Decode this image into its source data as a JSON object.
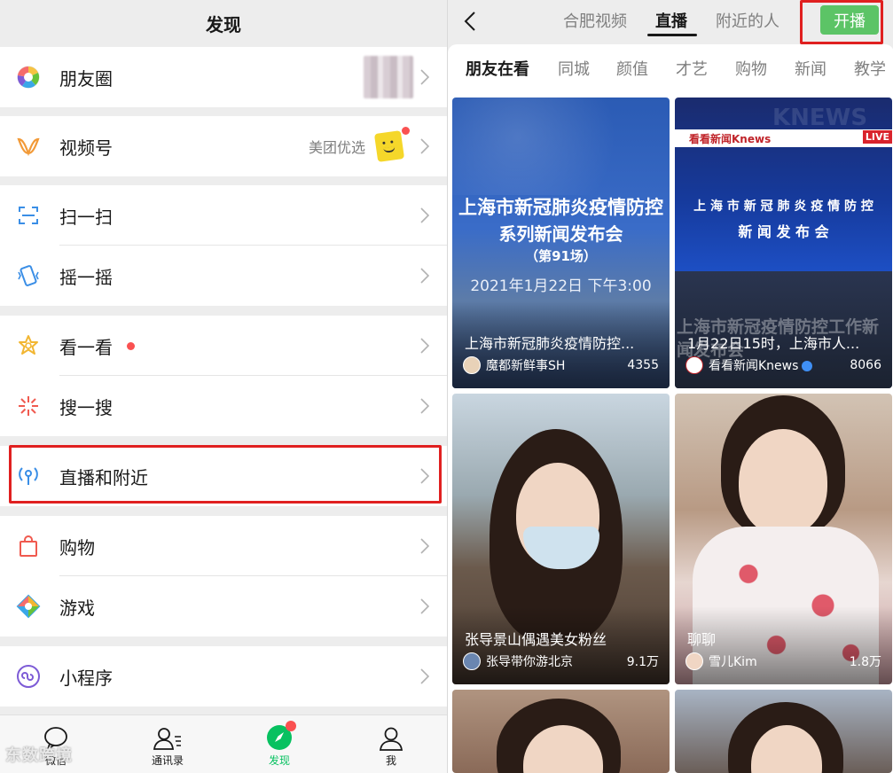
{
  "left": {
    "title": "发现",
    "items": {
      "moments": "朋友圈",
      "channels": "视频号",
      "channels_sub": "美团优选",
      "scan": "扫一扫",
      "shake": "摇一摇",
      "top_stories": "看一看",
      "search": "搜一搜",
      "live_nearby": "直播和附近",
      "shopping": "购物",
      "games": "游戏",
      "mini_programs": "小程序"
    },
    "tabbar": [
      "微信",
      "通讯录",
      "发现",
      "我"
    ],
    "watermark": "东数跨境"
  },
  "right": {
    "top_tabs": [
      "合肥视频",
      "直播",
      "附近的人"
    ],
    "go_live": "开播",
    "categories": [
      "朋友在看",
      "同城",
      "颜值",
      "才艺",
      "购物",
      "新闻",
      "教学"
    ],
    "cards": [
      {
        "title": "上海市新冠肺炎疫情防控...",
        "author": "魔都新鲜事SH",
        "views": "4355",
        "poster_line1": "上海市新冠肺炎疫情防控",
        "poster_line2": "系列新闻发布会",
        "poster_line3": "（第91场）",
        "poster_line4": "2021年1月22日 下午3:00"
      },
      {
        "title": "1月22日15时，上海市人...",
        "author": "看看新闻Knews",
        "views": "8066",
        "poster_brand": "看看新闻Knews",
        "poster_live": "LIVE",
        "poster_line1": "上 海 市 新 冠 肺 炎 疫 情 防 控",
        "poster_line2": "新 闻 发 布 会",
        "poster_overlay": "上海市新冠疫情防控工作新闻发布会",
        "poster_bg": "KNEWS"
      },
      {
        "title": "张导景山偶遇美女粉丝",
        "author": "张导带你游北京",
        "views": "9.1万"
      },
      {
        "title": "聊聊",
        "author": "雪儿Kim",
        "views": "1.8万"
      }
    ]
  },
  "colors": {
    "accent": "#07c160",
    "live_button": "#5cc466",
    "highlight": "#e02020",
    "badge": "#fa5151"
  }
}
